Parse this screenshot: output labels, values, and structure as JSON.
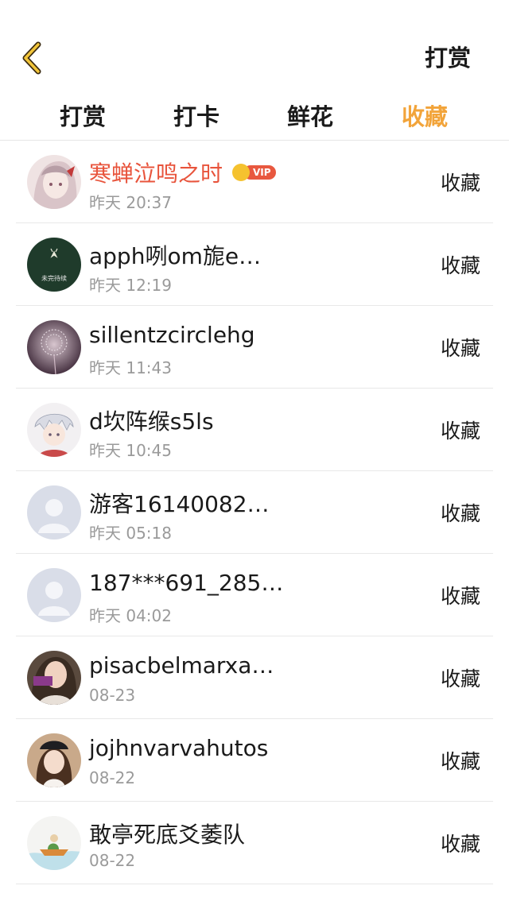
{
  "header": {
    "action_label": "打赏"
  },
  "tabs": [
    {
      "label": "打赏",
      "active": false
    },
    {
      "label": "打卡",
      "active": false
    },
    {
      "label": "鲜花",
      "active": false
    },
    {
      "label": "收藏",
      "active": true
    }
  ],
  "colors": {
    "accent": "#f2a43a",
    "vip_name": "#e8543c",
    "time": "#9a9a9a",
    "divider": "#e8e8e8"
  },
  "list": [
    {
      "name": "寒蝉泣鸣之时",
      "vip": true,
      "vip_label": "VIP",
      "time": "昨天 20:37",
      "action": "收藏",
      "avatar": "anime-girl-avatar"
    },
    {
      "name": "apph咧om旎e…",
      "vip": false,
      "time": "昨天 12:19",
      "action": "收藏",
      "avatar": "dark-green-avatar",
      "avatar_text": "未完待续"
    },
    {
      "name": "sillentzcirclehg",
      "vip": false,
      "time": "昨天 11:43",
      "action": "收藏",
      "avatar": "dandelion-avatar"
    },
    {
      "name": "d坎阵缑s5ls",
      "vip": false,
      "time": "昨天 10:45",
      "action": "收藏",
      "avatar": "anime-boy-avatar"
    },
    {
      "name": "游客16140082…",
      "vip": false,
      "time": "昨天 05:18",
      "action": "收藏",
      "avatar": "default-user-avatar"
    },
    {
      "name": "187***691_285…",
      "vip": false,
      "time": "昨天 04:02",
      "action": "收藏",
      "avatar": "default-user-avatar"
    },
    {
      "name": "pisacbelmarxa…",
      "vip": false,
      "time": "08-23",
      "action": "收藏",
      "avatar": "girl-photo-avatar"
    },
    {
      "name": "jojhnvarvahutos",
      "vip": false,
      "time": "08-22",
      "action": "收藏",
      "avatar": "girl-cap-avatar"
    },
    {
      "name": "敢亭死底爻萎队",
      "vip": false,
      "time": "08-22",
      "action": "收藏",
      "avatar": "boat-illustration-avatar"
    }
  ]
}
